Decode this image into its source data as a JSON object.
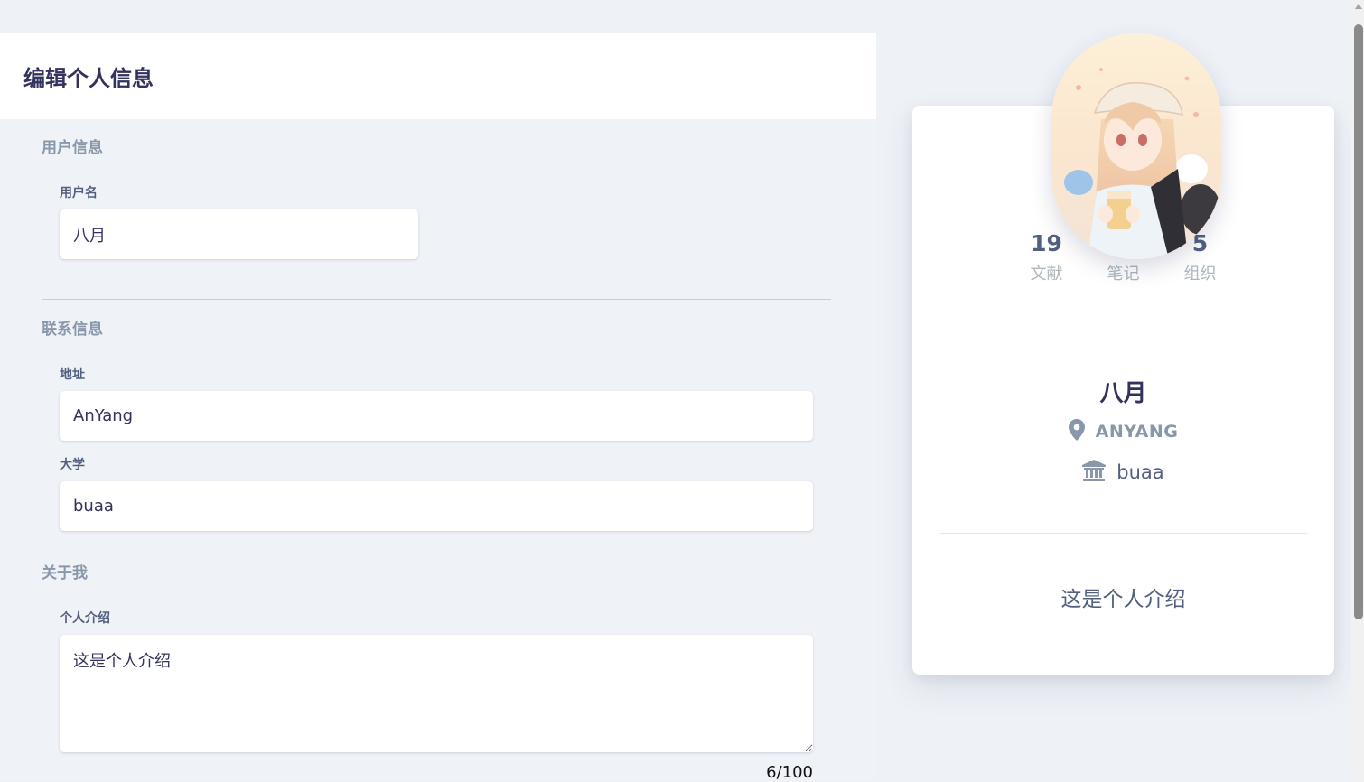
{
  "edit_form": {
    "title": "编辑个人信息",
    "sections": {
      "user_info": "用户信息",
      "contact_info": "联系信息",
      "about_me": "关于我"
    },
    "fields": {
      "username": {
        "label": "用户名",
        "value": "八月"
      },
      "address": {
        "label": "地址",
        "value": "AnYang"
      },
      "university": {
        "label": "大学",
        "value": "buaa"
      },
      "bio": {
        "label": "个人介绍",
        "value": "这是个人介绍",
        "char_count": "6/100"
      }
    }
  },
  "profile_card": {
    "stats": [
      {
        "value": "19",
        "label": "文献"
      },
      {
        "value": "",
        "label": "笔记"
      },
      {
        "value": "5",
        "label": "组织"
      }
    ],
    "name": "八月",
    "location": "ANYANG",
    "school": "buaa",
    "bio": "这是个人介绍",
    "avatar_icon": "anime-girl-avatar",
    "location_icon": "map-pin-icon",
    "school_icon": "university-icon"
  },
  "colors": {
    "background": "#eef2f7",
    "card": "#ffffff",
    "heading": "#32325d",
    "muted": "#8898aa"
  }
}
